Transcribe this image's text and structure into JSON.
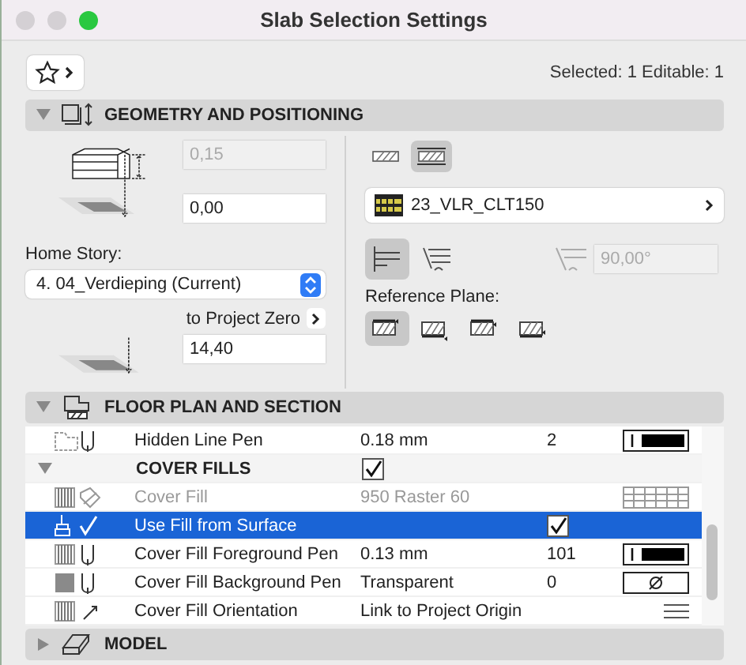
{
  "window": {
    "title": "Slab Selection Settings"
  },
  "toolbar": {
    "selection_info": "Selected: 1 Editable: 1"
  },
  "geometry": {
    "title": "GEOMETRY AND POSITIONING",
    "expanded": true,
    "thickness": {
      "value": "0,15",
      "disabled": true
    },
    "offset": {
      "value": "0,00",
      "disabled": false
    },
    "home_story_label": "Home Story:",
    "home_story": "4. 04_Verdieping (Current)",
    "to_project_zero": "to Project Zero",
    "elevation": {
      "value": "14,40",
      "disabled": false
    },
    "structure_modes": [
      {
        "kind": "basic",
        "selected": false
      },
      {
        "kind": "composite",
        "selected": true
      }
    ],
    "composite": "23_VLR_CLT150",
    "edge_modes": [
      {
        "kind": "perpendicular",
        "selected": true
      },
      {
        "kind": "angled",
        "selected": false
      }
    ],
    "edge_angle": {
      "value": "90,00°",
      "disabled": true
    },
    "reference_plane_label": "Reference Plane:",
    "reference_planes": [
      {
        "selected": true
      },
      {
        "selected": false
      },
      {
        "selected": false
      },
      {
        "selected": false
      }
    ]
  },
  "floor_plan": {
    "title": "FLOOR PLAN AND SECTION",
    "expanded": true,
    "rows": [
      {
        "kind": "pen",
        "label": "Hidden Line Pen",
        "value": "0.18 mm",
        "number": "2",
        "disabled": false,
        "selected": false
      },
      {
        "kind": "group",
        "label": "COVER FILLS",
        "checked": true,
        "expanded": true,
        "selected": false
      },
      {
        "kind": "fill",
        "label": "Cover Fill",
        "value": "950 Raster 60",
        "disabled": true,
        "selected": false
      },
      {
        "kind": "check",
        "label": "Use Fill from Surface",
        "checked": true,
        "disabled": false,
        "selected": true
      },
      {
        "kind": "pen",
        "label": "Cover Fill Foreground Pen",
        "value": "0.13 mm",
        "number": "101",
        "disabled": false,
        "selected": false
      },
      {
        "kind": "pen",
        "label": "Cover Fill Background Pen",
        "value": "Transparent",
        "number": "0",
        "disabled": false,
        "selected": false
      },
      {
        "kind": "fill",
        "label": "Cover Fill Orientation",
        "value": "Link to Project Origin",
        "disabled": false,
        "selected": false
      }
    ]
  },
  "model": {
    "title": "MODEL",
    "expanded": false
  }
}
